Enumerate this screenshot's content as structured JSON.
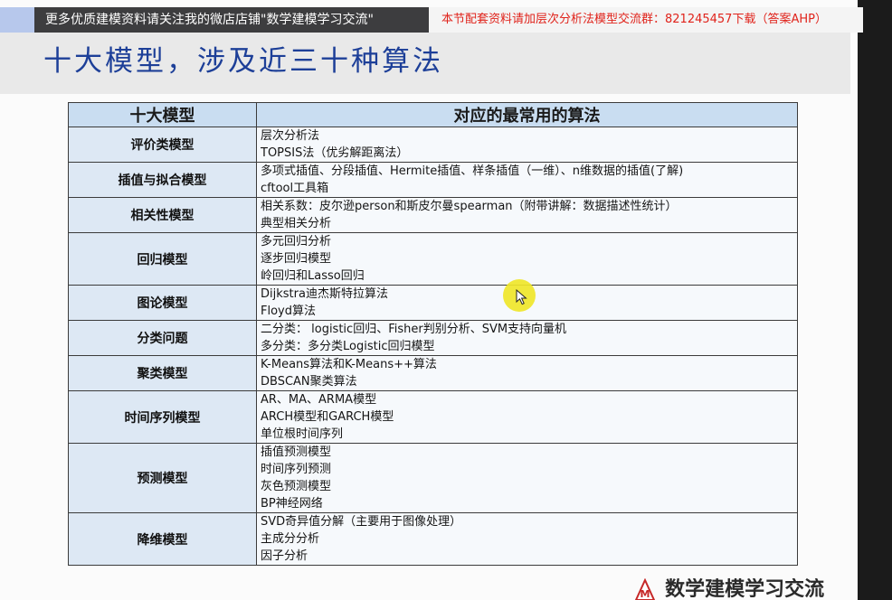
{
  "banner": {
    "left_text": "更多优质建模资料请关注我的微店店铺\"数学建模学习交流\"",
    "right_text": "本节配套资料请加层次分析法模型交流群：821245457下载（答案AHP）"
  },
  "title": "十大模型，涉及近三十种算法",
  "table": {
    "headers": [
      "十大模型",
      "对应的最常用的算法"
    ],
    "rows": [
      {
        "model": "评价类模型",
        "algos": [
          "层次分析法",
          "TOPSIS法（优劣解距离法）"
        ]
      },
      {
        "model": "插值与拟合模型",
        "algos": [
          "多项式插值、分段插值、Hermite插值、样条插值（一维）、n维数据的插值(了解)",
          "cftool工具箱"
        ]
      },
      {
        "model": "相关性模型",
        "algos": [
          " 相关系数：皮尔逊person和斯皮尔曼spearman（附带讲解：数据描述性统计）",
          "典型相关分析"
        ]
      },
      {
        "model": "回归模型",
        "algos": [
          "多元回归分析",
          "逐步回归模型",
          "岭回归和Lasso回归"
        ]
      },
      {
        "model": "图论模型",
        "algos": [
          "Dijkstra迪杰斯特拉算法",
          "Floyd算法"
        ]
      },
      {
        "model": "分类问题",
        "algos": [
          "二分类：  logistic回归、Fisher判别分析、SVM支持向量机",
          "多分类：多分类Logistic回归模型"
        ]
      },
      {
        "model": "聚类模型",
        "algos": [
          "K-Means算法和K-Means++算法",
          "DBSCAN聚类算法"
        ]
      },
      {
        "model": "时间序列模型",
        "algos": [
          "AR、MA、ARMA模型",
          "ARCH模型和GARCH模型",
          "单位根时间序列"
        ]
      },
      {
        "model": "预测模型",
        "algos": [
          "插值预测模型",
          "时间序列预测",
          "灰色预测模型",
          "BP神经网络"
        ]
      },
      {
        "model": "降维模型",
        "algos": [
          "SVD奇异值分解（主要用于图像处理）",
          "主成分分析",
          "因子分析"
        ]
      }
    ]
  },
  "watermark": {
    "logo_letter": "M",
    "text": "数学建模学习交流"
  },
  "colors": {
    "title": "#1d3f98",
    "banner_right_text": "#e0231b",
    "header_bg": "#c9ddf1",
    "model_cell_bg": "#dde8f4",
    "cursor_highlight": "#efe62a"
  }
}
